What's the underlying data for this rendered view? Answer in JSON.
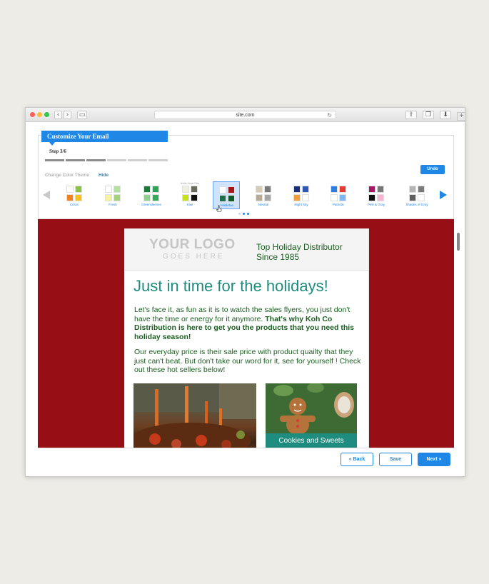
{
  "browser": {
    "url": "site.com",
    "reload_icon": "↻"
  },
  "wizard": {
    "title": "Customize Your Email",
    "step": "Step 3/6",
    "progress": {
      "completed": 3,
      "total": 6
    },
    "change_label": "Change Color Theme",
    "hide_label": "Hide",
    "undo_label": "Undo"
  },
  "themes": [
    {
      "label": "Citrus",
      "colors": [
        "#ffffff",
        "#8bc34a",
        "#f2821f",
        "#f7c21e"
      ]
    },
    {
      "label": "Fresh",
      "colors": [
        "#ffffff",
        "#b2e0a0",
        "#f3f3a0",
        "#a3d17c"
      ]
    },
    {
      "label": "Greensleeves",
      "colors": [
        "#1b7a3a",
        "#2fa157",
        "#8fd08f",
        "#3aa85a"
      ]
    },
    {
      "label": "Kiwi",
      "colors": [
        "#f0f0e0",
        "#6b6b5a",
        "#c6e026",
        "#111111"
      ],
      "caption": "Hollie Hosie Pies"
    },
    {
      "label": "Mistletoe",
      "colors": [
        "#ffffff",
        "#a3151b",
        "#1e6f4e",
        "#0e5a2c"
      ],
      "selected": true
    },
    {
      "label": "Neutral",
      "colors": [
        "#d7cbb5",
        "#7a7a7a",
        "#b8ab95",
        "#a6a6a6"
      ]
    },
    {
      "label": "Night Sky",
      "colors": [
        "#1a2f7a",
        "#2f58b5",
        "#f2a03c",
        "#ffffff"
      ]
    },
    {
      "label": "Patriotic",
      "colors": [
        "#2e7de0",
        "#e63b35",
        "#ffffff",
        "#7fb8f0"
      ]
    },
    {
      "label": "Pink & Gray",
      "colors": [
        "#a51560",
        "#777777",
        "#111111",
        "#f3b6d0"
      ]
    },
    {
      "label": "Shades of Gray",
      "colors": [
        "#b5b5b5",
        "#7a7a7a",
        "#5e5e5e",
        "#ffffff"
      ]
    }
  ],
  "pager": {
    "pages": 3,
    "current": 2
  },
  "email": {
    "logo_line1": "YOUR LOGO",
    "logo_line2": "GOES HERE",
    "tagline_line1": "Top Holiday Distributor",
    "tagline_line2": "Since 1985",
    "headline": "Just in time for the holidays!",
    "para1_normal": "Let's face it, as fun as it is to watch the sales flyers, you just don't have the time or energy for it anymore. ",
    "para1_bold": "That's why Koh Co Distribution is here to get you the products that you need this holiday season!",
    "para2": "Our everyday price is their sale price with product quailty that they just can't beat. But don't take our word for it, see for yourself ! Check out these hot sellers below!",
    "product2_label": "Cookies and Sweets"
  },
  "footer": {
    "back_label": "« Back",
    "save_label": "Save",
    "next_label": "Next »"
  },
  "colors": {
    "accent": "#1f87e5",
    "preview_bg": "#980e15",
    "headline": "#1e8c7e",
    "body_text": "#1b5e20"
  }
}
